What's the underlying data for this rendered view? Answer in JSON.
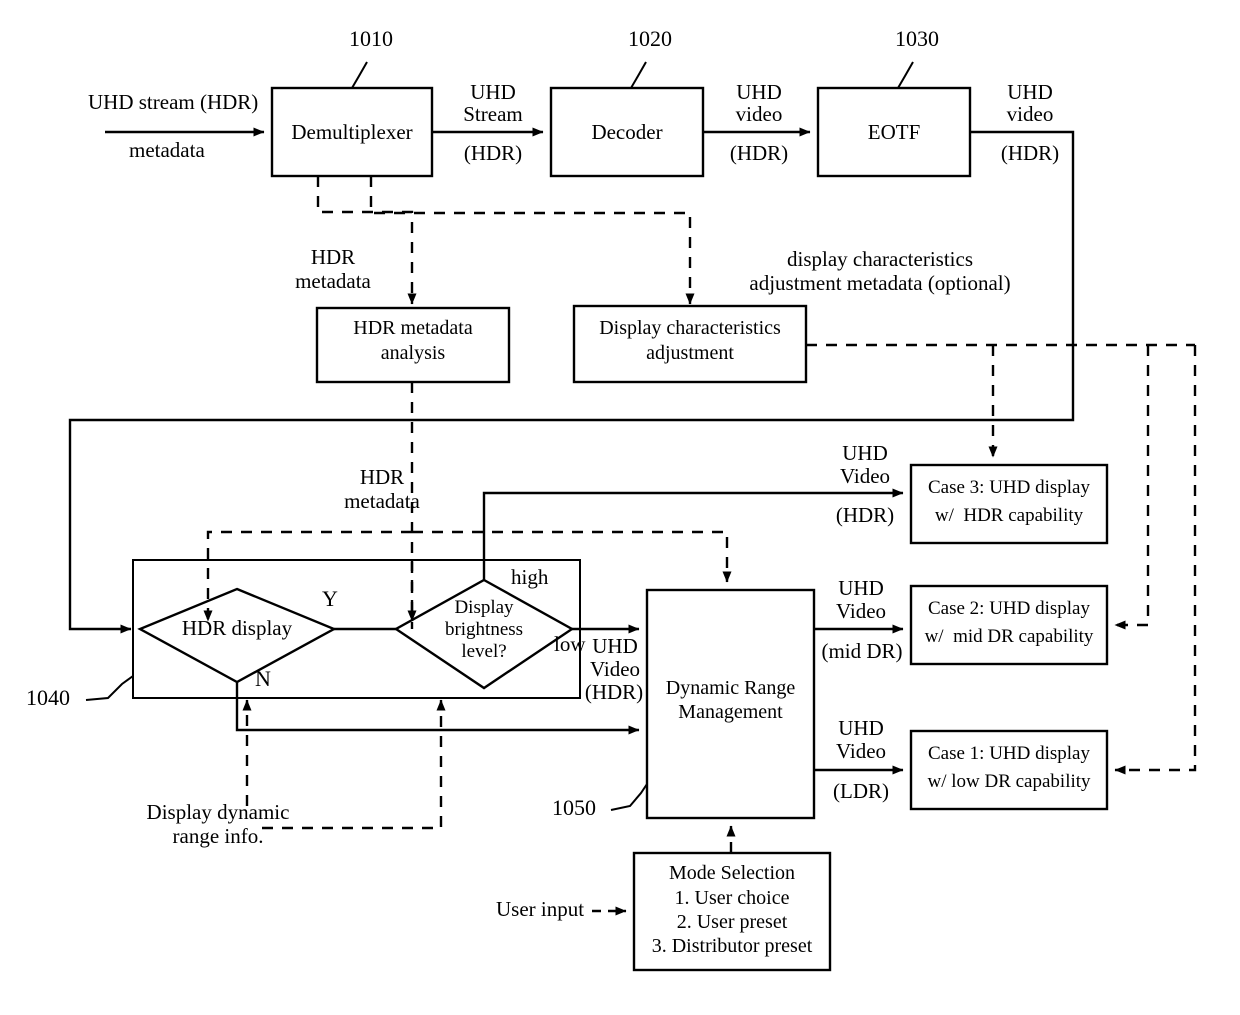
{
  "figure": {
    "type": "patent-block-diagram",
    "background": "#ffffff",
    "line_color": "#000000"
  },
  "ref_numerals": {
    "demux": "1010",
    "decoder": "1020",
    "eotf": "1030",
    "decision_group": "1040",
    "drm": "1050"
  },
  "boxes": {
    "demux": "Demultiplexer",
    "decoder": "Decoder",
    "eotf": "EOTF",
    "hdr_meta_analysis_l1": "HDR metadata",
    "hdr_meta_analysis_l2": "analysis",
    "disp_char_adjust_l1": "Display characteristics",
    "disp_char_adjust_l2": "adjustment",
    "drm_l1": "Dynamic Range",
    "drm_l2": "Management",
    "case3_l1": "Case 3: UHD display",
    "case3_l2": "w/  HDR capability",
    "case2_l1": "Case 2: UHD display",
    "case2_l2": "w/  mid DR capability",
    "case1_l1": "Case 1: UHD display",
    "case1_l2": "w/ low DR capability",
    "mode_sel_l1": "Mode Selection",
    "mode_sel_l2": "1. User choice",
    "mode_sel_l3": "2. User preset",
    "mode_sel_l4": "3. Distributor preset"
  },
  "decisions": {
    "hdr_display": "HDR display",
    "brightness_l1": "Display",
    "brightness_l2": "brightness",
    "brightness_l3": "level?",
    "branch_yes": "Y",
    "branch_no": "N",
    "branch_high": "high",
    "branch_low": "low"
  },
  "edge_labels": {
    "input_l1": "UHD stream (HDR)",
    "input_l2": "metadata",
    "demux_out_l1": "UHD",
    "demux_out_l2": "Stream",
    "demux_out_l3": "(HDR)",
    "decoder_out_l1": "UHD",
    "decoder_out_l2": "video",
    "decoder_out_l3": "(HDR)",
    "eotf_out_l1": "UHD",
    "eotf_out_l2": "video",
    "eotf_out_l3": "(HDR)",
    "hdr_metadata_top_l1": "HDR",
    "hdr_metadata_top_l2": "metadata",
    "disp_char_meta_l1": "display characteristics",
    "disp_char_meta_l2": "adjustment metadata (optional)",
    "hdr_metadata_mid_l1": "HDR",
    "hdr_metadata_mid_l2": "metadata",
    "case3_in_l1": "UHD",
    "case3_in_l2": "Video",
    "case3_in_l3": "(HDR)",
    "case2_in_l1": "UHD",
    "case2_in_l2": "Video",
    "case2_in_l3": "(mid DR)",
    "case1_in_l1": "UHD",
    "case1_in_l2": "Video",
    "case1_in_l3": "(LDR)",
    "drm_in_l1": "UHD",
    "drm_in_l2": "Video",
    "drm_in_l3": "(HDR)",
    "display_dr_info_l1": "Display dynamic",
    "display_dr_info_l2": "range info.",
    "user_input": "User input"
  }
}
